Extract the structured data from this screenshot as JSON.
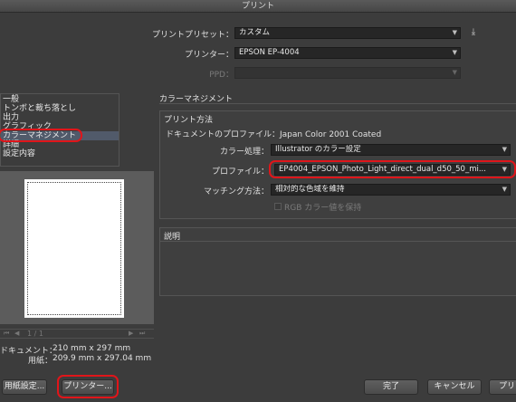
{
  "window": {
    "title": "プリント"
  },
  "top": {
    "preset_label": "プリントプリセット：",
    "preset_value": "カスタム",
    "printer_label": "プリンター：",
    "printer_value": "EPSON EP-4004",
    "ppd_label": "PPD：",
    "ppd_value": ""
  },
  "sidebar": {
    "items": [
      "一般",
      "トンボと裁ち落とし",
      "出力",
      "グラフィック",
      "カラーマネジメント",
      "詳細",
      "設定内容"
    ],
    "selected_index": 4
  },
  "preview": {
    "page_indicator": "1 / 1",
    "doc_label": "ドキュメント：",
    "doc_size": "210 mm x 297 mm",
    "paper_label": "用紙：",
    "paper_size": "209.9 mm x 297.04 mm"
  },
  "color_management": {
    "section_title": "カラーマネジメント",
    "print_method_title": "プリント方法",
    "doc_profile": "ドキュメントのプロファイル：Japan Color 2001 Coated",
    "color_handling_label": "カラー処理：",
    "color_handling_value": "Illustrator のカラー設定",
    "profile_label": "プロファイル：",
    "profile_value": "EP4004_EPSON_Photo_Light_direct_dual_d50_50_mi...",
    "intent_label": "マッチング方法：",
    "intent_value": "相対的な色域を維持",
    "preserve_rgb_label": "RGB カラー値を保持"
  },
  "description": {
    "title": "説明"
  },
  "buttons": {
    "page_setup": "用紙設定...",
    "printer": "プリンター...",
    "done": "完了",
    "cancel": "キャンセル",
    "print": "プリ"
  },
  "icons": {
    "save_preset": "save-preset-icon"
  },
  "colors": {
    "highlight_ring": "#e0151a",
    "background": "#3c3c3c"
  }
}
